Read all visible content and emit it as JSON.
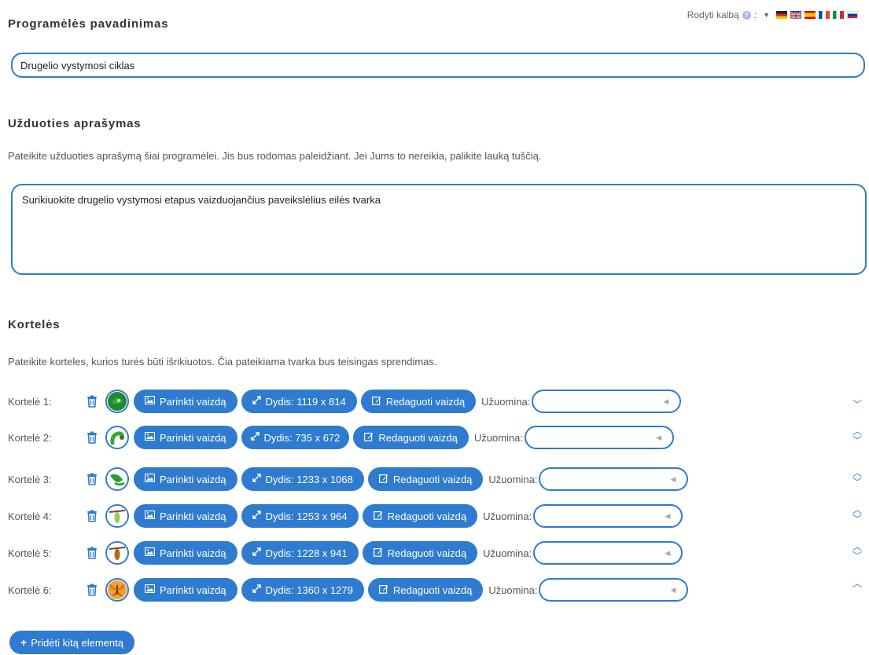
{
  "header": {
    "title": "Programėlės pavadinimas",
    "show_language_label": "Rodyti kalbą",
    "help_glyph": "?",
    "separator": ":",
    "flags": [
      "de",
      "gb",
      "es",
      "fr",
      "it",
      "ru"
    ]
  },
  "app_title": {
    "value": "Drugelio vystymosi ciklas"
  },
  "task": {
    "title": "Užduoties aprašymas",
    "description": "Pateikite užduoties aprašymą šiai programėlei. Jis bus rodomas paleidžiant. Jei Jums to nereikia, palikite lauką tuščią.",
    "value": "Surikiuokite drugelio vystymosi etapus vaizduojančius paveikslėlius eilės tvarka"
  },
  "cards": {
    "title": "Kortelės",
    "description": "Pateikite korteles, kurios turės būti išrikiuotos. Čia pateikiama tvarka bus teisingas sprendimas.",
    "choose_image_label": "Parinkti vaizdą",
    "edit_image_label": "Redaguoti vaizdą",
    "hint_label": "Užuomina:",
    "items": [
      {
        "label": "Kortelė 1:",
        "size": "Dydis: 1119 x 814",
        "thumb": "leaf-egg",
        "hint": ""
      },
      {
        "label": "Kortelė 2:",
        "size": "Dydis: 735 x 672",
        "thumb": "caterpillar",
        "hint": ""
      },
      {
        "label": "Kortelė 3:",
        "size": "Dydis: 1233 x 1068",
        "thumb": "caterpillar-leaf",
        "hint": ""
      },
      {
        "label": "Kortelė 4:",
        "size": "Dydis: 1253 x 964",
        "thumb": "chrysalis-green",
        "hint": ""
      },
      {
        "label": "Kortelė 5:",
        "size": "Dydis: 1228 x 941",
        "thumb": "chrysalis-brown",
        "hint": ""
      },
      {
        "label": "Kortelė 6:",
        "size": "Dydis: 1360 x 1279",
        "thumb": "butterfly",
        "hint": ""
      }
    ],
    "add_label": "Pridėti kitą elementą"
  },
  "colors": {
    "accent": "#2e7bcf",
    "text": "#333333",
    "muted": "#555555"
  },
  "icons": {
    "delete": "trash-icon",
    "image": "image-icon",
    "resize": "resize-icon",
    "edit": "edit-icon",
    "up": "chevron-up-icon",
    "down": "chevron-down-icon",
    "dropdown": "triangle-left-icon"
  }
}
